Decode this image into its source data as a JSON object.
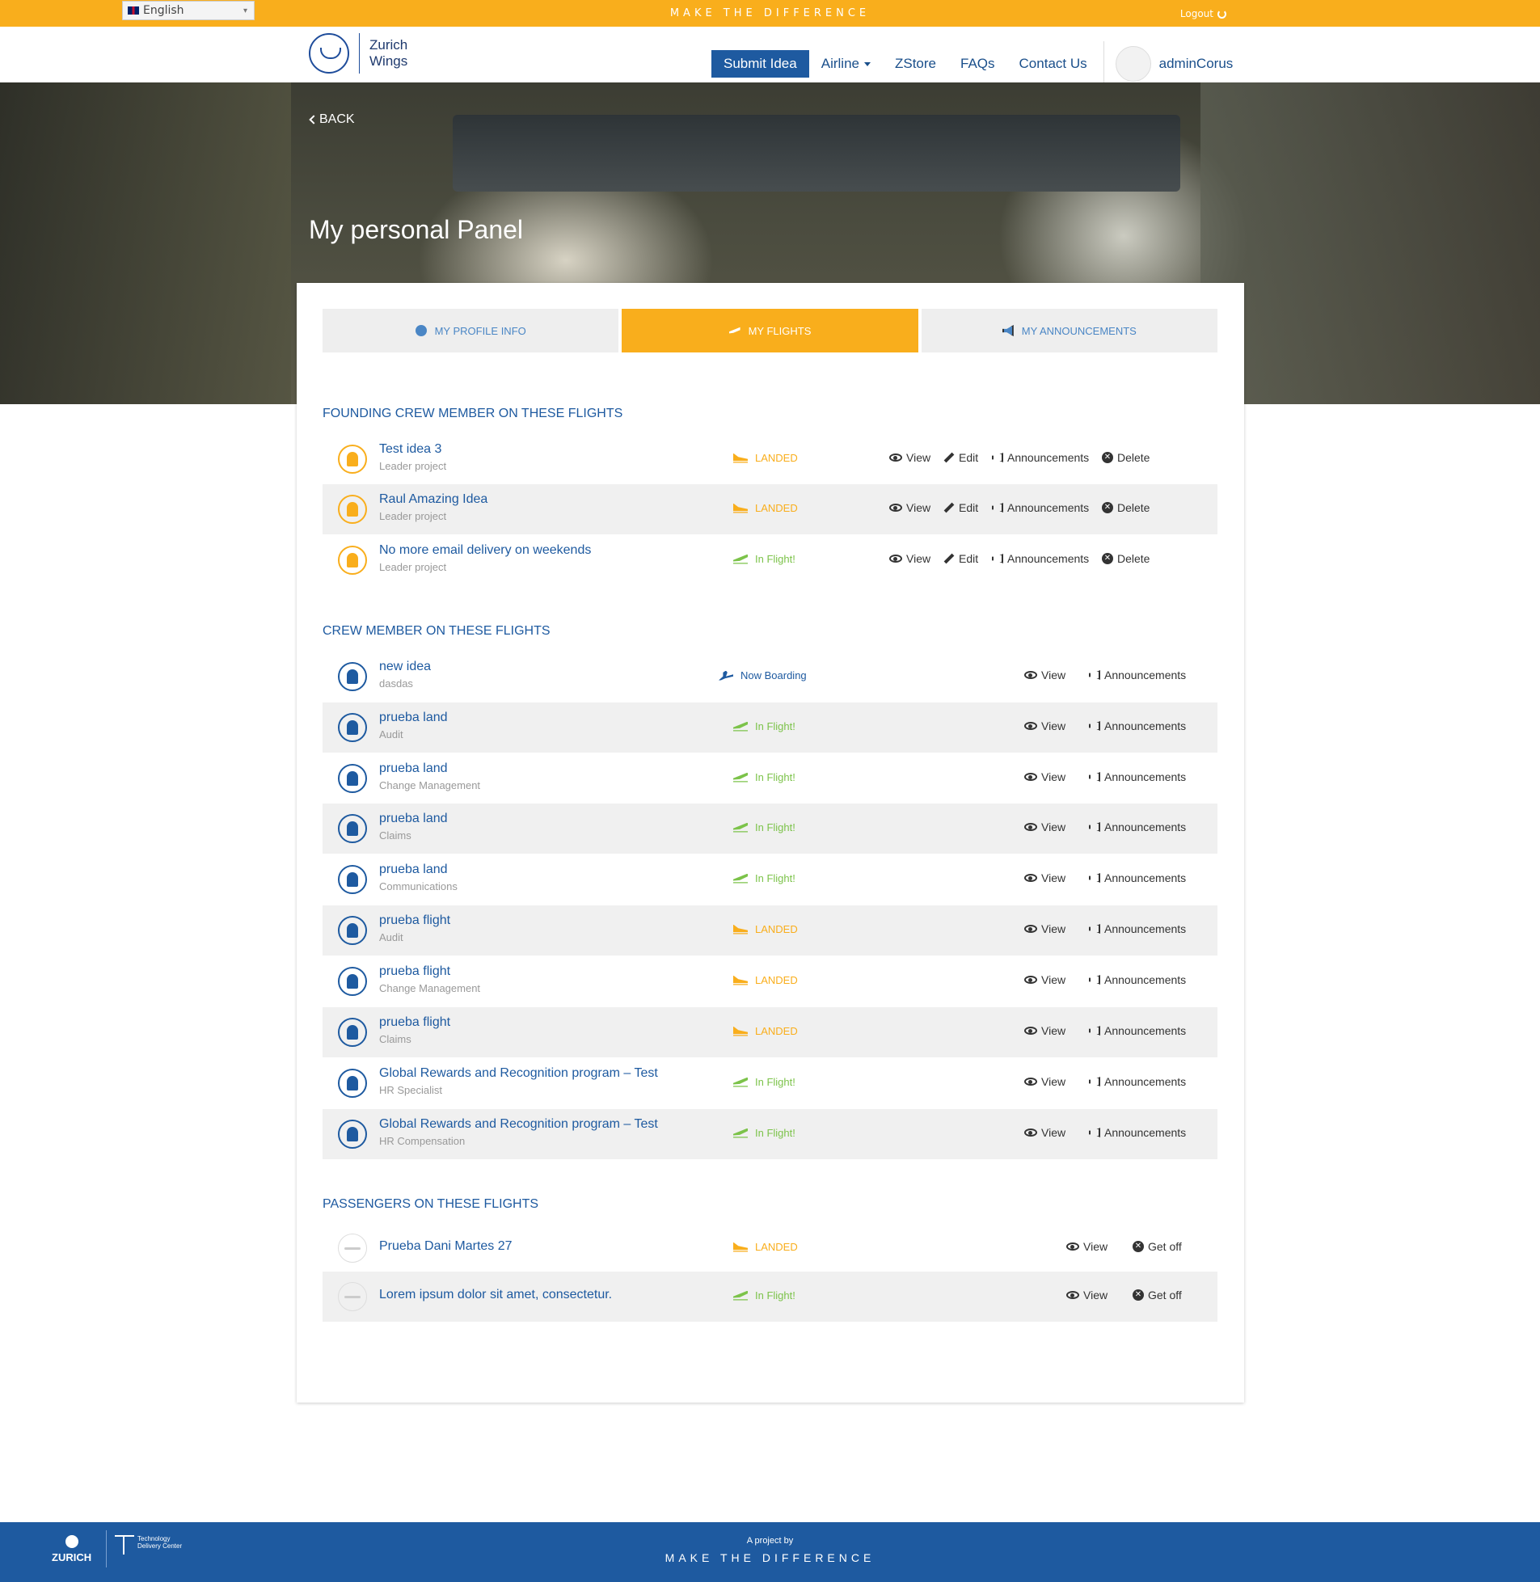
{
  "topbar": {
    "language": "English",
    "tagline": "MAKE THE DIFFERENCE",
    "logout": "Logout"
  },
  "brand": {
    "line1": "Zurich",
    "line2": "Wings"
  },
  "nav": {
    "submit": "Submit Idea",
    "airline": "Airline",
    "zstore": "ZStore",
    "faqs": "FAQs",
    "contact": "Contact Us",
    "username": "adminCorus"
  },
  "hero": {
    "back": "BACK",
    "title": "My personal Panel"
  },
  "tabs": [
    {
      "label": "MY PROFILE INFO"
    },
    {
      "label": "MY FLIGHTS"
    },
    {
      "label": "MY ANNOUNCEMENTS"
    }
  ],
  "actions": {
    "view": "View",
    "edit": "Edit",
    "announcements": "Announcements",
    "delete": "Delete",
    "getoff": "Get off"
  },
  "founding": {
    "title": "FOUNDING CREW MEMBER ON THESE FLIGHTS",
    "rows": [
      {
        "title": "Test idea 3",
        "sub": "Leader project",
        "status": "LANDED"
      },
      {
        "title": "Raul Amazing Idea",
        "sub": "Leader project",
        "status": "LANDED"
      },
      {
        "title": "No more email delivery on weekends",
        "sub": "Leader project",
        "status": "In Flight!"
      }
    ]
  },
  "crew": {
    "title": "CREW MEMBER ON THESE FLIGHTS",
    "rows": [
      {
        "title": "new idea",
        "sub": "dasdas",
        "status": "Now Boarding"
      },
      {
        "title": "prueba land",
        "sub": "Audit",
        "status": "In Flight!"
      },
      {
        "title": "prueba land",
        "sub": "Change Management",
        "status": "In Flight!"
      },
      {
        "title": "prueba land",
        "sub": "Claims",
        "status": "In Flight!"
      },
      {
        "title": "prueba land",
        "sub": "Communications",
        "status": "In Flight!"
      },
      {
        "title": "prueba flight",
        "sub": "Audit",
        "status": "LANDED"
      },
      {
        "title": "prueba flight",
        "sub": "Change Management",
        "status": "LANDED"
      },
      {
        "title": "prueba flight",
        "sub": "Claims",
        "status": "LANDED"
      },
      {
        "title": "Global Rewards and Recognition program – Test",
        "sub": "HR Specialist",
        "status": "In Flight!"
      },
      {
        "title": "Global Rewards and Recognition program – Test",
        "sub": "HR Compensation",
        "status": "In Flight!"
      }
    ]
  },
  "passengers": {
    "title": "PASSENGERS ON THESE FLIGHTS",
    "rows": [
      {
        "title": "Prueba Dani Martes 27",
        "status": "LANDED"
      },
      {
        "title": "Lorem ipsum dolor sit amet, consectetur.",
        "status": "In Flight!"
      }
    ]
  },
  "footer": {
    "zurich": "ZURICH",
    "tdc_line1": "Technology",
    "tdc_line2": "Delivery Center",
    "project_by": "A project by",
    "tagline": "MAKE THE DIFFERENCE"
  },
  "colors": {
    "accent": "#f9ae1c",
    "brand_blue": "#1e5aa0",
    "landed": "#f9ae1c",
    "inflight": "#7cc34a"
  }
}
